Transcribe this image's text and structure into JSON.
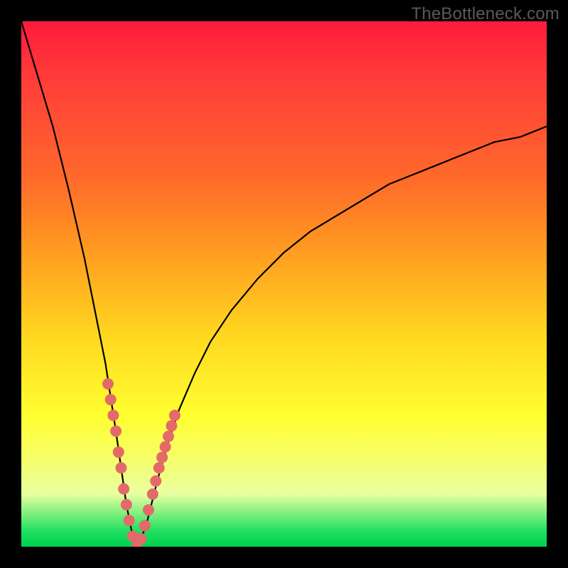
{
  "watermark": "TheBottleneck.com",
  "colors": {
    "frame": "#000000",
    "marker": "#e46a6a",
    "curve": "#000000",
    "gradient_top": "#ff1a3c",
    "gradient_bottom": "#00d050"
  },
  "chart_data": {
    "type": "line",
    "title": "",
    "xlabel": "",
    "ylabel": "",
    "xlim": [
      0,
      100
    ],
    "ylim": [
      0,
      100
    ],
    "note": "V-shaped curve; y is bottleneck-like score (0 at minimum near x≈22, rising steeply to ~100 at x=0 and gradually toward ~80 at x=100). Axes have no tick labels in image; values are estimates from pixel geometry.",
    "series": [
      {
        "name": "curve",
        "x": [
          0,
          3,
          6,
          9,
          12,
          14,
          16,
          18,
          19,
          20,
          21,
          22,
          23,
          24,
          25,
          26,
          28,
          30,
          33,
          36,
          40,
          45,
          50,
          55,
          60,
          65,
          70,
          75,
          80,
          85,
          90,
          95,
          100
        ],
        "y": [
          100,
          90,
          80,
          68,
          55,
          45,
          35,
          22,
          15,
          8,
          3,
          0,
          2,
          5,
          9,
          13,
          20,
          26,
          33,
          39,
          45,
          51,
          56,
          60,
          63,
          66,
          69,
          71,
          73,
          75,
          77,
          78,
          80
        ]
      }
    ],
    "markers": {
      "name": "highlighted-points",
      "x": [
        16.5,
        17.0,
        17.5,
        18.0,
        18.5,
        19.0,
        19.5,
        20.0,
        20.5,
        21.2,
        22.0,
        22.8,
        23.5,
        24.2,
        25.0,
        25.6,
        26.2,
        26.8,
        27.4,
        28.0,
        28.6,
        29.2
      ],
      "y": [
        31,
        28,
        25,
        22,
        18,
        15,
        11,
        8,
        5,
        2,
        0,
        1.5,
        4,
        7,
        10,
        12.5,
        15,
        17,
        19,
        21,
        23,
        25
      ]
    }
  }
}
